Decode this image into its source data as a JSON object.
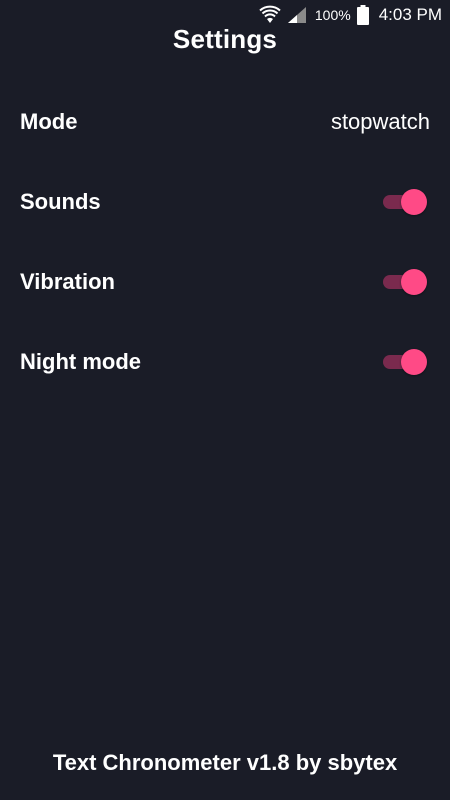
{
  "status_bar": {
    "battery_percent": "100%",
    "time": "4:03 PM",
    "icons": [
      "wifi-icon",
      "signal-icon",
      "battery-icon"
    ]
  },
  "header": {
    "title": "Settings"
  },
  "settings": {
    "mode": {
      "label": "Mode",
      "value": "stopwatch"
    },
    "sounds": {
      "label": "Sounds",
      "enabled": true
    },
    "vibration": {
      "label": "Vibration",
      "enabled": true
    },
    "night_mode": {
      "label": "Night mode",
      "enabled": true
    }
  },
  "footer": {
    "credit": "Text Chronometer v1.8 by sbytex"
  },
  "colors": {
    "background": "#1a1c27",
    "accent": "#ff4a86",
    "toggle_track": "#7a2a4e",
    "text": "#ffffff"
  }
}
